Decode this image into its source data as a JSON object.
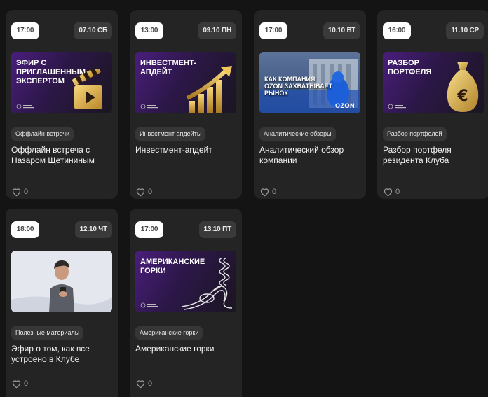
{
  "cards": [
    {
      "time": "17:00",
      "date": "07.10 СБ",
      "thumb_title": "ЭФИР С\nПРИГЛАШЕННЫМ\nЭКСПЕРТОМ",
      "thumb_icon": "clapperboard-icon",
      "tag": "Оффлайн встречи",
      "title": "Оффлайн встреча с Назаром Щетининым",
      "likes": "0"
    },
    {
      "time": "13:00",
      "date": "09.10 ПН",
      "thumb_title": "ИНВЕСТМЕНТ-\nАПДЕЙТ",
      "thumb_icon": "growth-chart-icon",
      "tag": "Инвестмент апдейты",
      "title": "Инвестмент-апдейт",
      "likes": "0"
    },
    {
      "time": "17:00",
      "date": "10.10 ВТ",
      "thumb_title": "КАК КОМПАНИЯ\nOZON ЗАХВАТЫВАЕТ\nРЫНОК",
      "thumb_brand": "OZON",
      "tag": "Аналитические обзоры",
      "title": "Аналитический обзор компании",
      "likes": "0"
    },
    {
      "time": "16:00",
      "date": "11.10 СР",
      "thumb_title": "РАЗБОР\nПОРТФЕЛЯ",
      "thumb_icon": "money-bag-icon",
      "tag": "Разбор портфелей",
      "title": "Разбор портфеля резидента Клуба",
      "likes": "0"
    },
    {
      "time": "18:00",
      "date": "12.10 ЧТ",
      "thumb_icon": "person-phone-illustration",
      "tag": "Полезные материалы",
      "title": "Эфир о том, как все устроено в Клубе",
      "likes": "0"
    },
    {
      "time": "17:00",
      "date": "13.10 ПТ",
      "thumb_title": "АМЕРИКАНСКИЕ\nГОРКИ",
      "thumb_icon": "rollercoaster-icon",
      "tag": "Американские горки",
      "title": "Американские горки",
      "likes": "0"
    }
  ],
  "colors": {
    "card_bg": "#242424",
    "page_bg": "#141414",
    "accent_purple": "#4a1e7c",
    "gold": "#e6b84a"
  }
}
